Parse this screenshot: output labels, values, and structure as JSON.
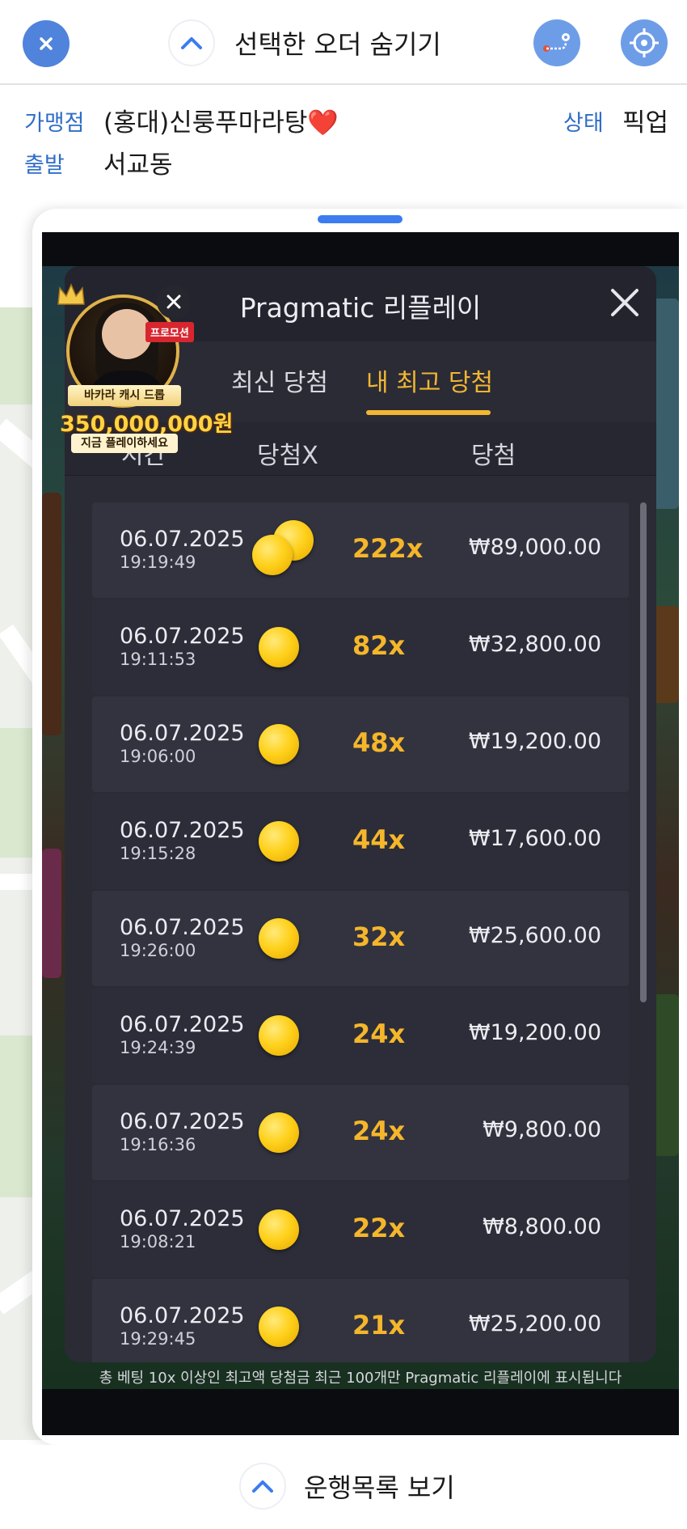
{
  "topbar": {
    "hide_order_label": "선택한 오더 숨기기"
  },
  "order": {
    "merchant_label": "가맹점",
    "merchant_value": "(홍대)신룽푸마라탕❤️",
    "status_label": "상태",
    "status_value": "픽업",
    "depart_label": "출발",
    "depart_value": "서교동"
  },
  "modal": {
    "title": "Pragmatic 리플레이",
    "tabs": [
      {
        "label": "최신 당첨",
        "active": false
      },
      {
        "label": "내 최고 당첨",
        "active": true
      }
    ],
    "columns": {
      "time": "시간",
      "multiplier": "당첨X",
      "win": "당첨"
    },
    "rows": [
      {
        "date": "06.07.2025",
        "time": "19:19:49",
        "coins": 2,
        "multiplier": "222x",
        "amount": "₩89,000.00"
      },
      {
        "date": "06.07.2025",
        "time": "19:11:53",
        "coins": 1,
        "multiplier": "82x",
        "amount": "₩32,800.00"
      },
      {
        "date": "06.07.2025",
        "time": "19:06:00",
        "coins": 1,
        "multiplier": "48x",
        "amount": "₩19,200.00"
      },
      {
        "date": "06.07.2025",
        "time": "19:15:28",
        "coins": 1,
        "multiplier": "44x",
        "amount": "₩17,600.00"
      },
      {
        "date": "06.07.2025",
        "time": "19:26:00",
        "coins": 1,
        "multiplier": "32x",
        "amount": "₩25,600.00"
      },
      {
        "date": "06.07.2025",
        "time": "19:24:39",
        "coins": 1,
        "multiplier": "24x",
        "amount": "₩19,200.00"
      },
      {
        "date": "06.07.2025",
        "time": "19:16:36",
        "coins": 1,
        "multiplier": "24x",
        "amount": "₩9,800.00"
      },
      {
        "date": "06.07.2025",
        "time": "19:08:21",
        "coins": 1,
        "multiplier": "22x",
        "amount": "₩8,800.00"
      },
      {
        "date": "06.07.2025",
        "time": "19:29:45",
        "coins": 1,
        "multiplier": "21x",
        "amount": "₩25,200.00"
      }
    ],
    "footnote": "총 베팅 10x 이상인 최고액 당첨금 최근 100개만 Pragmatic 리플레이에 표시됩니다"
  },
  "promo": {
    "tag": "프로모션",
    "line1": "바카라 캐시 드롭",
    "amount": "350,000,000원",
    "line2": "지금 플레이하세요"
  },
  "bottombar": {
    "label": "운행목록 보기"
  },
  "colors": {
    "accent_blue": "#4f83dc",
    "label_blue": "#2f6dc8",
    "gold": "#f2b632",
    "modal_bg": "#2a2b35"
  }
}
